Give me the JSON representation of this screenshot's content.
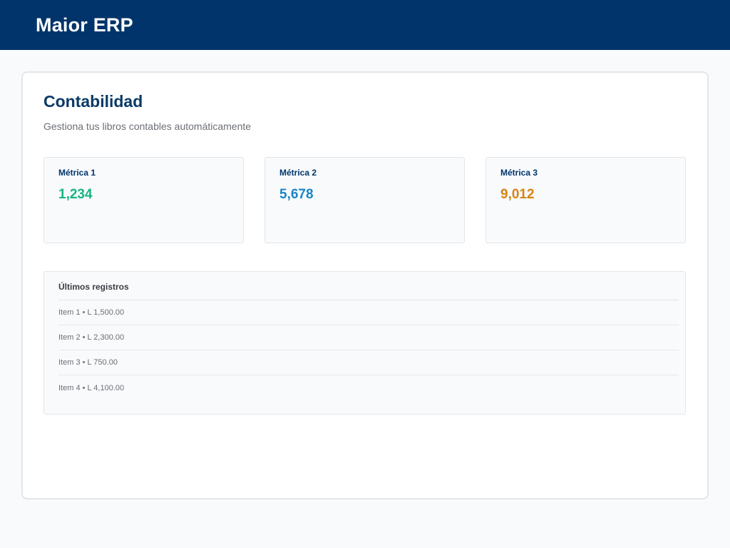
{
  "header": {
    "brand": "Maior ERP"
  },
  "page": {
    "title": "Contabilidad",
    "subtitle": "Gestiona tus libros contables automáticamente"
  },
  "metrics": [
    {
      "label": "Métrica 1",
      "value": "1,234",
      "color": "#16b57f"
    },
    {
      "label": "Métrica 2",
      "value": "5,678",
      "color": "#1a86c7"
    },
    {
      "label": "Métrica 3",
      "value": "9,012",
      "color": "#d98314"
    }
  ],
  "records": {
    "title": "Últimos registros",
    "items": [
      {
        "text": "Item 1 • L 1,500.00"
      },
      {
        "text": "Item 2 • L 2,300.00"
      },
      {
        "text": "Item 3 • L 750.00"
      },
      {
        "text": "Item 4 • L 4,100.00"
      }
    ]
  },
  "colors": {
    "header_bg": "#00346a",
    "title": "#0b3a66",
    "muted_text": "#6b6f75"
  }
}
